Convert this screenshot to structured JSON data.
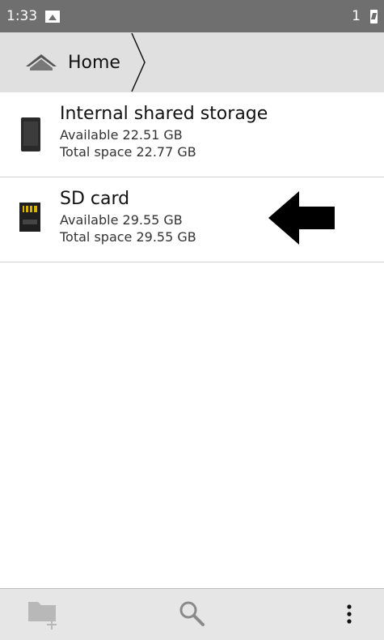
{
  "status_bar": {
    "time": "1:33",
    "notification_count": "1",
    "icons": [
      "image-icon",
      "battery-charging-icon"
    ]
  },
  "breadcrumb": {
    "home_label": "Home",
    "icon": "home-icon"
  },
  "storage_list": [
    {
      "title": "Internal shared storage",
      "available": "Available 22.51 GB",
      "total": "Total space 22.77 GB",
      "icon": "phone-storage-icon"
    },
    {
      "title": "SD card",
      "available": "Available 29.55 GB",
      "total": "Total space 29.55 GB",
      "icon": "sd-card-icon"
    }
  ],
  "annotation": {
    "icon": "left-arrow-pointer-icon",
    "color": "#000000"
  },
  "bottom_bar": {
    "icons": [
      "new-folder-icon",
      "search-icon",
      "overflow-menu-icon"
    ]
  },
  "colors": {
    "status_bar": "#6f6f6f",
    "breadcrumb_bar": "#e0e0e0",
    "bottom_bar": "#e6e6e6"
  }
}
